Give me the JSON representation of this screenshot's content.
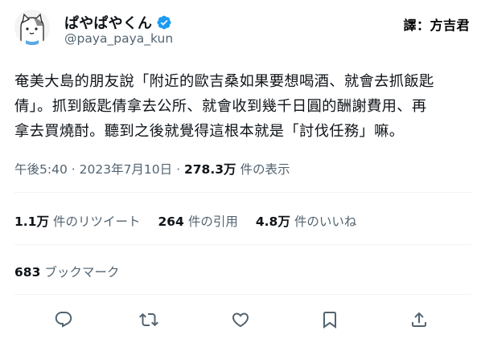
{
  "author": {
    "display_name": "ぱやぱやくん",
    "handle": "@paya_paya_kun",
    "avatar_icon": "cat-avatar-icon",
    "verified_icon": "verified-badge-icon",
    "verified_color": "#1d9bf0"
  },
  "translator_label": "譯：方吉君",
  "tweet": {
    "lines": [
      "奄美大島的朋友說「附近的歐吉桑如果要想喝酒、就會去抓飯匙",
      "倩」。抓到飯匙倩拿去公所、就會收到幾千日圓的酬謝費用、再",
      "拿去買燒酎。聽到之後就覺得這根本就是「討伐任務」嘛。"
    ]
  },
  "meta": {
    "time": "午後5:40",
    "separator": "·",
    "date": "2023年7月10日",
    "views_count": "278.3万",
    "views_label": "件の表示"
  },
  "stats": {
    "retweets_count": "1.1万",
    "retweets_label": "件のリツイート",
    "quotes_count": "264",
    "quotes_label": "件の引用",
    "likes_count": "4.8万",
    "likes_label": "件のいいね"
  },
  "bookmarks": {
    "count": "683",
    "label": "ブックマーク"
  },
  "actions": [
    {
      "name": "reply",
      "icon": "reply-icon"
    },
    {
      "name": "retweet",
      "icon": "retweet-icon"
    },
    {
      "name": "like",
      "icon": "heart-icon"
    },
    {
      "name": "bookmark",
      "icon": "bookmark-icon"
    },
    {
      "name": "share",
      "icon": "share-icon"
    }
  ],
  "colors": {
    "text": "#0f1419",
    "secondary": "#536471",
    "divider": "#eff3f4",
    "icon": "#536471"
  }
}
